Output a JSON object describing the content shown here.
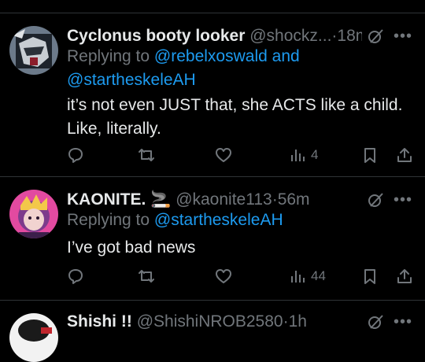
{
  "tweets": [
    {
      "name": "Cyclonus booty looker",
      "handle": "@shockz...",
      "sep": "·",
      "time": "18m",
      "replying_prefix": "Replying to",
      "replying_to_1": "@rebelxoswald",
      "replying_and": "and",
      "replying_to_2": "@startheskeleAH",
      "text_line1": "it’s not even JUST that, she ACTS like a child.",
      "text_line2": "Like, literally.",
      "views": "4"
    },
    {
      "name": "KAONITE.",
      "name_emoji": "🚬",
      "handle": "@kaonite113",
      "sep": "·",
      "time": "56m",
      "replying_prefix": "Replying to",
      "replying_to_1": "@startheskeleAH",
      "text_line1": "I’ve got bad news",
      "views": "44"
    },
    {
      "name": "Shishi !!",
      "handle": "@ShishiNROB2580",
      "sep": "·",
      "time": "1h"
    }
  ],
  "colors": {
    "background": "#000000",
    "text": "#e7e9ea",
    "secondary": "#71767b",
    "link": "#1d9bf0",
    "divider": "#2f3336"
  },
  "icons": [
    "grok-icon",
    "more-icon",
    "reply-icon",
    "retweet-icon",
    "like-icon",
    "views-icon",
    "bookmark-icon",
    "share-icon"
  ]
}
